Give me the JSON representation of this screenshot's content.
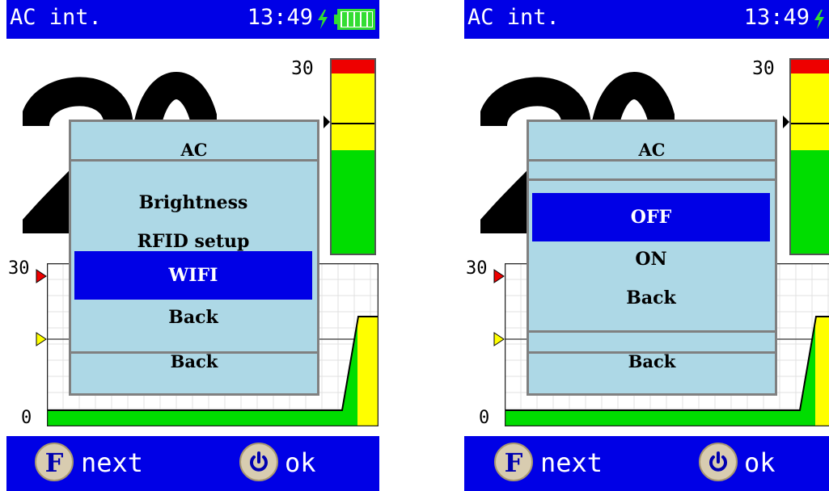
{
  "status": {
    "title": "AC int.",
    "time": "13:49"
  },
  "meter": {
    "scale_max": "30"
  },
  "plot": {
    "top_label": "30",
    "bottom_label": "0"
  },
  "footer": {
    "next_label": "next",
    "ok_label": "ok",
    "f_key": "F"
  },
  "colors": {
    "bar": "#0000e6",
    "dialog_bg": "#add8e6",
    "selected": "#0000e6",
    "gauge_red": "#ee0000",
    "gauge_yellow": "#ffff00",
    "gauge_green": "#00dd00"
  },
  "left_screen": {
    "dialog": {
      "peek_top": "AC",
      "peek_bottom": "Back",
      "items": [
        {
          "label": "Brightness",
          "selected": false
        },
        {
          "label": "RFID setup",
          "selected": false
        },
        {
          "label": "WIFI",
          "selected": true
        },
        {
          "label": "Back",
          "selected": false
        }
      ]
    }
  },
  "right_screen": {
    "dialog": {
      "peek_top": "AC",
      "peek_bottom": "Back",
      "items": [
        {
          "label": "OFF",
          "selected": true
        },
        {
          "label": "ON",
          "selected": false
        },
        {
          "label": "Back",
          "selected": false
        }
      ]
    }
  }
}
